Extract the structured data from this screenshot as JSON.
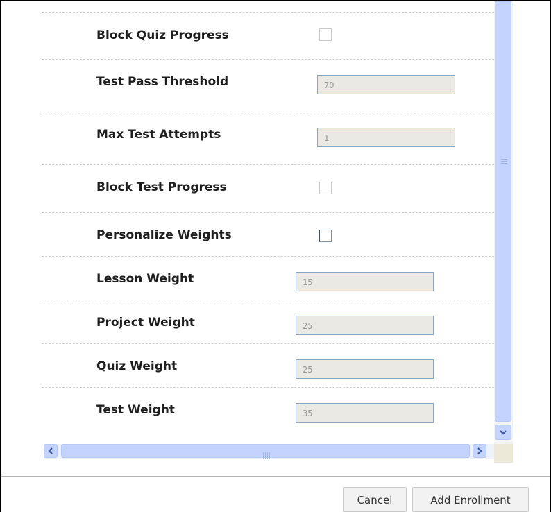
{
  "rows": [
    {
      "label": "Block Quiz Progress",
      "type": "checkbox",
      "checked": false
    },
    {
      "label": "Test Pass Threshold",
      "type": "input",
      "value": "70"
    },
    {
      "label": "Max Test Attempts",
      "type": "input",
      "value": "1"
    },
    {
      "label": "Block Test Progress",
      "type": "checkbox",
      "checked": false
    },
    {
      "label": "Personalize Weights",
      "type": "checkbox",
      "checked": false
    },
    {
      "label": "Lesson Weight",
      "type": "input",
      "value": "15"
    },
    {
      "label": "Project Weight",
      "type": "input",
      "value": "25"
    },
    {
      "label": "Quiz Weight",
      "type": "input",
      "value": "25"
    },
    {
      "label": "Test Weight",
      "type": "input",
      "value": "35"
    }
  ],
  "footer": {
    "cancel_label": "Cancel",
    "add_enrollment_label": "Add Enrollment"
  },
  "scrollbar": {
    "left_arrow": "◀",
    "right_arrow": "▶",
    "down_arrow": "▼"
  }
}
